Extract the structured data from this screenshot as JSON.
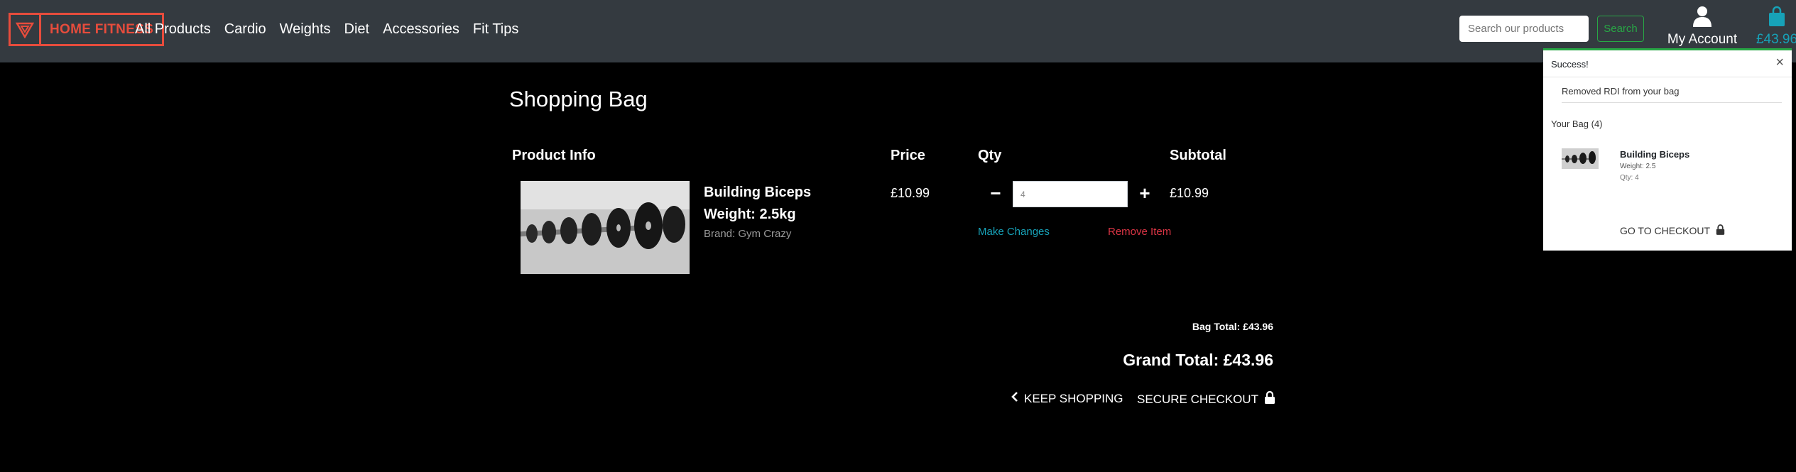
{
  "header": {
    "logo_text": "HOME FITNESS",
    "nav": [
      "All Products",
      "Cardio",
      "Weights",
      "Diet",
      "Accessories",
      "Fit Tips"
    ],
    "search_placeholder": "Search our products",
    "search_button": "Search",
    "account_label": "My Account",
    "bag_total": "£43.96"
  },
  "bag": {
    "title": "Shopping Bag",
    "columns": {
      "product_info": "Product Info",
      "price": "Price",
      "qty": "Qty",
      "subtotal": "Subtotal"
    },
    "item": {
      "name": "Building Biceps",
      "weight": "Weight: 2.5kg",
      "brand": "Brand: Gym Crazy",
      "price": "£10.99",
      "qty": "4",
      "subtotal": "£10.99",
      "make_changes": "Make Changes",
      "remove": "Remove Item"
    },
    "bag_total": "Bag Total: £43.96",
    "grand_total": "Grand Total: £43.96",
    "keep_shopping": "KEEP SHOPPING",
    "secure_checkout": "SECURE CHECKOUT"
  },
  "toast": {
    "title": "Success!",
    "message": "Removed RDI from your bag",
    "your_bag": "Your Bag (4)",
    "item_name": "Building Biceps",
    "item_weight": "Weight: 2.5",
    "item_qty": "Qty: 4",
    "checkout": "GO TO CHECKOUT"
  },
  "colors": {
    "header_bg": "#343a40",
    "brand": "#e74c3c",
    "accent": "#17a2b8",
    "success": "#28a745",
    "danger": "#dc3545"
  },
  "icons": [
    "logo-triangle-icon",
    "user-icon",
    "shopping-bag-icon",
    "chevron-left-icon",
    "lock-icon",
    "close-icon"
  ]
}
